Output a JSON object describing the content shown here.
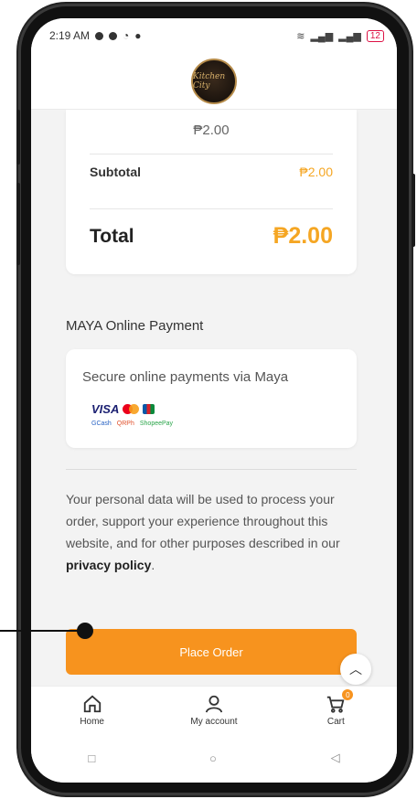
{
  "status_bar": {
    "time": "2:19 AM",
    "right_icons": "☰ %% ▐▐",
    "battery": "12"
  },
  "header": {
    "logo_text": "Kitchen City",
    "logo_icon": "restaurant-logo"
  },
  "order_summary": {
    "item_price": "₱2.00",
    "subtotal_label": "Subtotal",
    "subtotal_value": "₱2.00",
    "total_label": "Total",
    "total_value": "₱2.00"
  },
  "payment": {
    "method_title": "MAYA Online Payment",
    "description": "Secure online payments via Maya",
    "card_brands": "VISA",
    "wallets": [
      "GCash",
      "QRPh",
      "ShopeePay"
    ]
  },
  "privacy": {
    "text": "Your personal data will be used to process your order, support your experience throughout this website, and for other purposes described in our ",
    "link": "privacy policy",
    "end": "."
  },
  "actions": {
    "place_order": "Place Order",
    "scroll_top_icon": "chevron-up-icon"
  },
  "bottom_nav": {
    "items": [
      {
        "label": "Home",
        "icon": "home-icon"
      },
      {
        "label": "My account",
        "icon": "user-icon"
      },
      {
        "label": "Cart",
        "icon": "cart-icon",
        "badge": "0"
      }
    ]
  },
  "colors": {
    "accent": "#f7931e",
    "price": "#f5a623"
  }
}
